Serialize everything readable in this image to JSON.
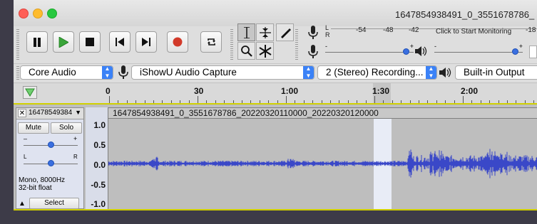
{
  "window": {
    "title": "1647854938491_0_3551678786_"
  },
  "transport": {
    "pause_label": "Pause",
    "play_label": "Play",
    "stop_label": "Stop",
    "skip_start_label": "Skip to Start",
    "skip_end_label": "Skip to End",
    "record_label": "Record",
    "loop_label": "Loop"
  },
  "meters": {
    "record_ticks": [
      "-54",
      "-48",
      "-42"
    ],
    "monitor_label": "Click to Start Monitoring",
    "right_tick": "-18",
    "playback_right_tick": "-1",
    "l_label": "L",
    "r_label": "R"
  },
  "mixer": {
    "record_volume": 0.95,
    "playback_volume": 0.95
  },
  "devices": {
    "host": "Core Audio",
    "recording_device": "iShowU Audio Capture",
    "channels": "2 (Stereo) Recording...",
    "playback_device": "Built-in Output"
  },
  "timeline": {
    "ticks": [
      "0",
      "30",
      "1:00",
      "1:30",
      "2:00"
    ]
  },
  "track": {
    "name": "16478549384",
    "mute_label": "Mute",
    "solo_label": "Solo",
    "gain_minus": "–",
    "gain_plus": "+",
    "pan_l": "L",
    "pan_r": "R",
    "info_rate": "Mono, 8000Hz",
    "info_format": "32-bit float",
    "select_label": "Select",
    "gain_value": 0.5,
    "pan_value": 0.5,
    "scale_labels": [
      "1.0",
      "0.5",
      "0.0",
      "-0.5",
      "-1.0"
    ],
    "clip_title": "1647854938491_0_3551678786_20220320110000_20220320120000"
  },
  "colors": {
    "waveform": "#3a48c8",
    "selection_track": "#d0d000",
    "record_red": "#d23a2a",
    "play_green": "#3aa53a",
    "combo_arrow": "#3b82f7"
  }
}
